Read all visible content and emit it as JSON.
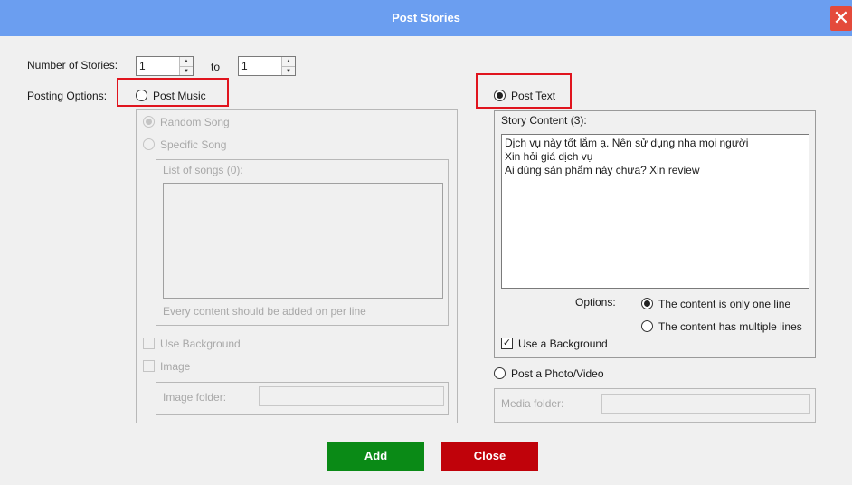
{
  "window": {
    "title": "Post Stories",
    "close_glyph": "✕"
  },
  "count": {
    "label": "Number of Stories:",
    "from": "1",
    "to_label": "to",
    "to": "1"
  },
  "options_label": "Posting Options:",
  "music": {
    "label": "Post Music",
    "random_song": "Random Song",
    "specific_song": "Specific Song",
    "songs_list_label": "List of songs (0):",
    "songs_hint": "Every content should be added on per line",
    "use_background": "Use Background",
    "image": "Image",
    "image_folder_label": "Image folder:",
    "image_folder_value": ""
  },
  "text": {
    "label": "Post Text",
    "content_label": "Story Content (3):",
    "content": "Dịch vụ này tốt lắm ạ. Nên sử dụng nha mọi người\nXin hỏi giá dịch vụ\nAi dùng sản phẩm này chưa? Xin review",
    "options_label": "Options:",
    "option_single": "The content is only one line",
    "option_multiple": "The content has multiple lines",
    "use_background": "Use a Background",
    "use_background_check": "✓"
  },
  "photo": {
    "label": "Post a Photo/Video",
    "media_folder_label": "Media folder:",
    "media_folder_value": ""
  },
  "buttons": {
    "add": "Add",
    "close": "Close"
  },
  "colors": {
    "titlebar": "#6b9ef0",
    "add": "#0a8a16",
    "close": "#c0020a",
    "highlight": "#e0141e"
  }
}
